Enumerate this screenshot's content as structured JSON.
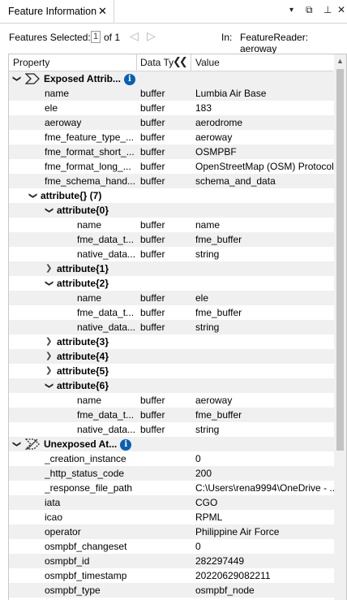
{
  "window": {
    "tab_title": "Feature Information",
    "close_glyph": "✕",
    "menu_glyph": "▾",
    "float_glyph": "⧉",
    "pin_glyph": "⊥",
    "winclose_glyph": "✕"
  },
  "toolbar": {
    "features_selected_label": "Features Selected:",
    "selected_value": "1",
    "of_label": "of 1",
    "prev_glyph": "◁",
    "next_glyph": "▷",
    "in_label": "In:",
    "reader": "FeatureReader: aeroway"
  },
  "table": {
    "headers": {
      "property": "Property",
      "data_type": "Data Ty",
      "value": "Value"
    },
    "collapse_glyph": "❮❮",
    "rows": [
      {
        "kind": "group",
        "level": 0,
        "icon": "exposed",
        "label": "Exposed Attrib...",
        "info": "i",
        "stripe": true
      },
      {
        "level": 2,
        "prop": "name",
        "type": "buffer",
        "value": "Lumbia Air Base",
        "stripe": true
      },
      {
        "level": 2,
        "prop": "ele",
        "type": "buffer",
        "value": "183",
        "stripe": false
      },
      {
        "level": 2,
        "prop": "aeroway",
        "type": "buffer",
        "value": "aerodrome",
        "stripe": true
      },
      {
        "level": 2,
        "prop": "fme_feature_type_...",
        "type": "buffer",
        "value": "aeroway",
        "stripe": false
      },
      {
        "level": 2,
        "prop": "fme_format_short_...",
        "type": "buffer",
        "value": "OSMPBF",
        "stripe": true
      },
      {
        "level": 2,
        "prop": "fme_format_long_...",
        "type": "buffer",
        "value": "OpenStreetMap (OSM) Protocol",
        "stripe": false
      },
      {
        "level": 2,
        "prop": "fme_schema_hand...",
        "type": "buffer",
        "value": "schema_and_data",
        "stripe": true
      },
      {
        "kind": "node",
        "level": 1,
        "open": true,
        "label": "attribute{} (7)",
        "bold": true,
        "stripe": false
      },
      {
        "kind": "node",
        "level": 2,
        "open": true,
        "label": "attribute{0}",
        "bold": true,
        "stripe": true
      },
      {
        "level": 4,
        "prop": "name",
        "type": "buffer",
        "value": "name",
        "stripe": false
      },
      {
        "level": 4,
        "prop": "fme_data_t...",
        "type": "buffer",
        "value": "fme_buffer",
        "stripe": true
      },
      {
        "level": 4,
        "prop": "native_data...",
        "type": "buffer",
        "value": "string",
        "stripe": false
      },
      {
        "kind": "node",
        "level": 2,
        "open": false,
        "label": "attribute{1}",
        "bold": true,
        "stripe": true
      },
      {
        "kind": "node",
        "level": 2,
        "open": true,
        "label": "attribute{2}",
        "bold": true,
        "stripe": false
      },
      {
        "level": 4,
        "prop": "name",
        "type": "buffer",
        "value": "ele",
        "stripe": true
      },
      {
        "level": 4,
        "prop": "fme_data_t...",
        "type": "buffer",
        "value": "fme_buffer",
        "stripe": false
      },
      {
        "level": 4,
        "prop": "native_data...",
        "type": "buffer",
        "value": "string",
        "stripe": true
      },
      {
        "kind": "node",
        "level": 2,
        "open": false,
        "label": "attribute{3}",
        "bold": true,
        "stripe": false
      },
      {
        "kind": "node",
        "level": 2,
        "open": false,
        "label": "attribute{4}",
        "bold": true,
        "stripe": true
      },
      {
        "kind": "node",
        "level": 2,
        "open": false,
        "label": "attribute{5}",
        "bold": true,
        "stripe": false
      },
      {
        "kind": "node",
        "level": 2,
        "open": true,
        "label": "attribute{6}",
        "bold": true,
        "stripe": true
      },
      {
        "level": 4,
        "prop": "name",
        "type": "buffer",
        "value": "aeroway",
        "stripe": false
      },
      {
        "level": 4,
        "prop": "fme_data_t...",
        "type": "buffer",
        "value": "fme_buffer",
        "stripe": true
      },
      {
        "level": 4,
        "prop": "native_data...",
        "type": "buffer",
        "value": "string",
        "stripe": false
      },
      {
        "kind": "group",
        "level": 0,
        "icon": "unexposed",
        "label": "Unexposed At...",
        "info": "i",
        "stripe": true
      },
      {
        "level": 2,
        "prop": "_creation_instance",
        "type": "",
        "value": "0",
        "stripe": false
      },
      {
        "level": 2,
        "prop": "_http_status_code",
        "type": "",
        "value": "200",
        "stripe": true
      },
      {
        "level": 2,
        "prop": "_response_file_path",
        "type": "",
        "value": "C:\\Users\\rena9994\\OneDrive - ...",
        "stripe": false
      },
      {
        "level": 2,
        "prop": "iata",
        "type": "",
        "value": "CGO",
        "stripe": true
      },
      {
        "level": 2,
        "prop": "icao",
        "type": "",
        "value": "RPML",
        "stripe": false
      },
      {
        "level": 2,
        "prop": "operator",
        "type": "",
        "value": "Philippine Air Force",
        "stripe": true
      },
      {
        "level": 2,
        "prop": "osmpbf_changeset",
        "type": "",
        "value": "0",
        "stripe": false
      },
      {
        "level": 2,
        "prop": "osmpbf_id",
        "type": "",
        "value": "282297449",
        "stripe": true
      },
      {
        "level": 2,
        "prop": "osmpbf_timestamp",
        "type": "",
        "value": "20220629082211",
        "stripe": false
      },
      {
        "level": 2,
        "prop": "osmpbf_type",
        "type": "",
        "value": "osmpbf_node",
        "stripe": true
      }
    ]
  },
  "colors": {
    "stripe": "#f0f0f0",
    "info": "#0a5fb4"
  }
}
